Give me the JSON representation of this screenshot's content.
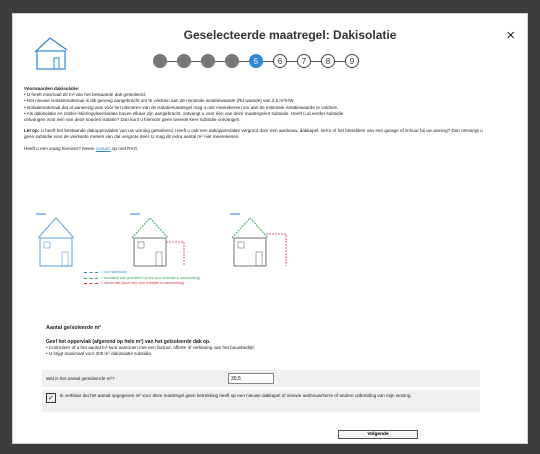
{
  "header": {
    "title": "Geselecteerde maatregel: Dakisolatie",
    "close_glyph": "×"
  },
  "steps": [
    {
      "label": "1",
      "state": "done"
    },
    {
      "label": "2",
      "state": "done"
    },
    {
      "label": "3",
      "state": "done"
    },
    {
      "label": "4",
      "state": "done"
    },
    {
      "label": "5",
      "state": "active"
    },
    {
      "label": "6",
      "state": "todo"
    },
    {
      "label": "7",
      "state": "todo"
    },
    {
      "label": "8",
      "state": "todo"
    },
    {
      "label": "9",
      "state": "todo"
    }
  ],
  "conditions": {
    "heading": "Voorwaarden dakisolatie:",
    "items": [
      "• U heeft minimaal 20 m² van het bestaande dak geïsoleerd.",
      "• Het nieuwe isolatiemateriaal is dik genoeg aangebracht om te voldoen aan de minimale isolatiewaarde (Rd waarde) van 3,5 m²K/W.",
      "• Isolatiemateriaal dat al aanwezig was vóór het uitvoeren van de isolatiemaatregel mag u niet meerekenen om aan de minimale isolatiewaarde te voldoen.",
      "• Als dakisolatie en zolder-/vlieringvloerisolatie boven elkaar zijn aangebracht, ontvangt u voor één van deze maatregelen subsidie. Heeft u al eerder subsidie",
      "ontvangen voor één van deze soorten isolatie? Dan kunt u hiervoor geen tweede keer subsidie ontvangen."
    ]
  },
  "note": {
    "prefix": "Let op:",
    "text": " U heeft het bestaande dakoppervlakte van uw woning geïsoleerd. Heeft u ook een dakoppervlakte vergroot door een aanbouw, dakkapel, serre of het betrekken van een garage of schuur bij uw woning? Dan ontvangt u geen subsidie voor de vierkante meters van dat vergrote deel. U mag dit extra aantal m² niet meerekenen."
  },
  "contact": {
    "before": "Heeft u een vraag hierover? Neem ",
    "link": "contact",
    "after": " op met RVO."
  },
  "legend": [
    {
      "label": "= voor aanbouw",
      "color": "#2e86d6"
    },
    {
      "label": "= bestaand dak geïsoleerd   (komt voor subsidie in aanmerking)",
      "color": "#3aa655"
    },
    {
      "label": "= nieuw dak (komt niet voor subsidie in aanmerking)",
      "color": "#d43a3a"
    }
  ],
  "section": {
    "title": "Aantal geïsoleerde m²",
    "lead": "Geef het oppervlak (afgerond op hele m²) van het geïsoleerde dak op.",
    "bullets": [
      "• Controleer of u het aantal m² kunt aantonen met een factuur, offerte of verklaring van het bouwbedrijf.",
      "• U krijgt maximaal voor 200 m² dakisolatie subsidie."
    ]
  },
  "form": {
    "question": "Wat is het aantal geïsoleerde m²?",
    "value": "30,5"
  },
  "declaration": {
    "checked": true,
    "check_glyph": "✓",
    "text": "Ik verklaar dat het aantal opgegeven m² voor deze maatregel geen betrekking heeft op een nieuwe dakkapel of nieuwe aanbouw/serre of andere uitbreiding van mijn woning."
  },
  "buttons": {
    "next": "Volgende"
  },
  "colors": {
    "accent": "#2e86d6",
    "house_icon": "#2e86d6"
  }
}
